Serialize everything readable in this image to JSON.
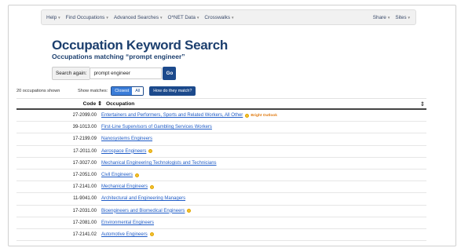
{
  "nav": {
    "left": [
      "Help",
      "Find Occupations",
      "Advanced Searches",
      "O*NET Data",
      "Crosswalks"
    ],
    "right": [
      "Share",
      "Sites"
    ]
  },
  "page": {
    "title": "Occupation Keyword Search",
    "subtitle": "Occupations matching “prompt engineer”"
  },
  "search": {
    "label": "Search again:",
    "value": "prompt engineer",
    "go_label": "Go"
  },
  "results": {
    "count_text": "20 occupations shown",
    "show_matches_label": "Show matches:",
    "toggle_closest": "Closest",
    "toggle_all": "All",
    "how_match_label": "How do they match?"
  },
  "table": {
    "col_code": "Code",
    "col_occupation": "Occupation",
    "rows": [
      {
        "code": "27-2099.00",
        "title": "Entertainers and Performers, Sports and Related Workers, All Other",
        "bright": true,
        "bright_label": "Bright Outlook"
      },
      {
        "code": "39-1013.00",
        "title": "First-Line Supervisors of Gambling Services Workers",
        "bright": false
      },
      {
        "code": "17-2199.09",
        "title": "Nanosystems Engineers",
        "bright": false
      },
      {
        "code": "17-2011.00",
        "title": "Aerospace Engineers",
        "bright": true
      },
      {
        "code": "17-3027.00",
        "title": "Mechanical Engineering Technologists and Technicians",
        "bright": false
      },
      {
        "code": "17-2051.00",
        "title": "Civil Engineers",
        "bright": true
      },
      {
        "code": "17-2141.00",
        "title": "Mechanical Engineers",
        "bright": true
      },
      {
        "code": "11-9041.00",
        "title": "Architectural and Engineering Managers",
        "bright": false
      },
      {
        "code": "17-2031.00",
        "title": "Bioengineers and Biomedical Engineers",
        "bright": true
      },
      {
        "code": "17-2081.00",
        "title": "Environmental Engineers",
        "bright": false
      },
      {
        "code": "17-2141.02",
        "title": "Automotive Engineers",
        "bright": true
      }
    ]
  },
  "colors": {
    "heading": "#1c3f6e",
    "link": "#1f5cc7",
    "button": "#1c4a8c",
    "bright_outlook": "#f2c230"
  }
}
